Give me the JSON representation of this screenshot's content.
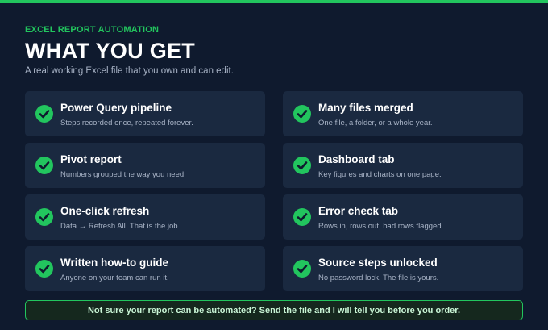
{
  "colors": {
    "accent": "#22c55e",
    "background": "#0f1a2e",
    "card": "#1a2940"
  },
  "header": {
    "eyebrow": "EXCEL REPORT AUTOMATION",
    "title": "WHAT YOU GET",
    "subtitle": "A real working Excel file that you own and can edit."
  },
  "features": [
    {
      "icon": "check-circle-icon",
      "title": "Power Query pipeline",
      "desc": "Steps recorded once, repeated forever."
    },
    {
      "icon": "check-circle-icon",
      "title": "Many files merged",
      "desc": "One file, a folder, or a whole year."
    },
    {
      "icon": "check-circle-icon",
      "title": "Pivot report",
      "desc": "Numbers grouped the way you need."
    },
    {
      "icon": "check-circle-icon",
      "title": "Dashboard tab",
      "desc": "Key figures and charts on one page."
    },
    {
      "icon": "check-circle-icon",
      "title": "One-click refresh",
      "desc": "Data → Refresh All. That is the job."
    },
    {
      "icon": "check-circle-icon",
      "title": "Error check tab",
      "desc": "Rows in, rows out, bad rows flagged."
    },
    {
      "icon": "check-circle-icon",
      "title": "Written how-to guide",
      "desc": "Anyone on your team can run it."
    },
    {
      "icon": "check-circle-icon",
      "title": "Source steps unlocked",
      "desc": "No password lock. The file is yours."
    }
  ],
  "cta": {
    "text": "Not sure your report can be automated? Send the file and I will tell you before you order."
  }
}
